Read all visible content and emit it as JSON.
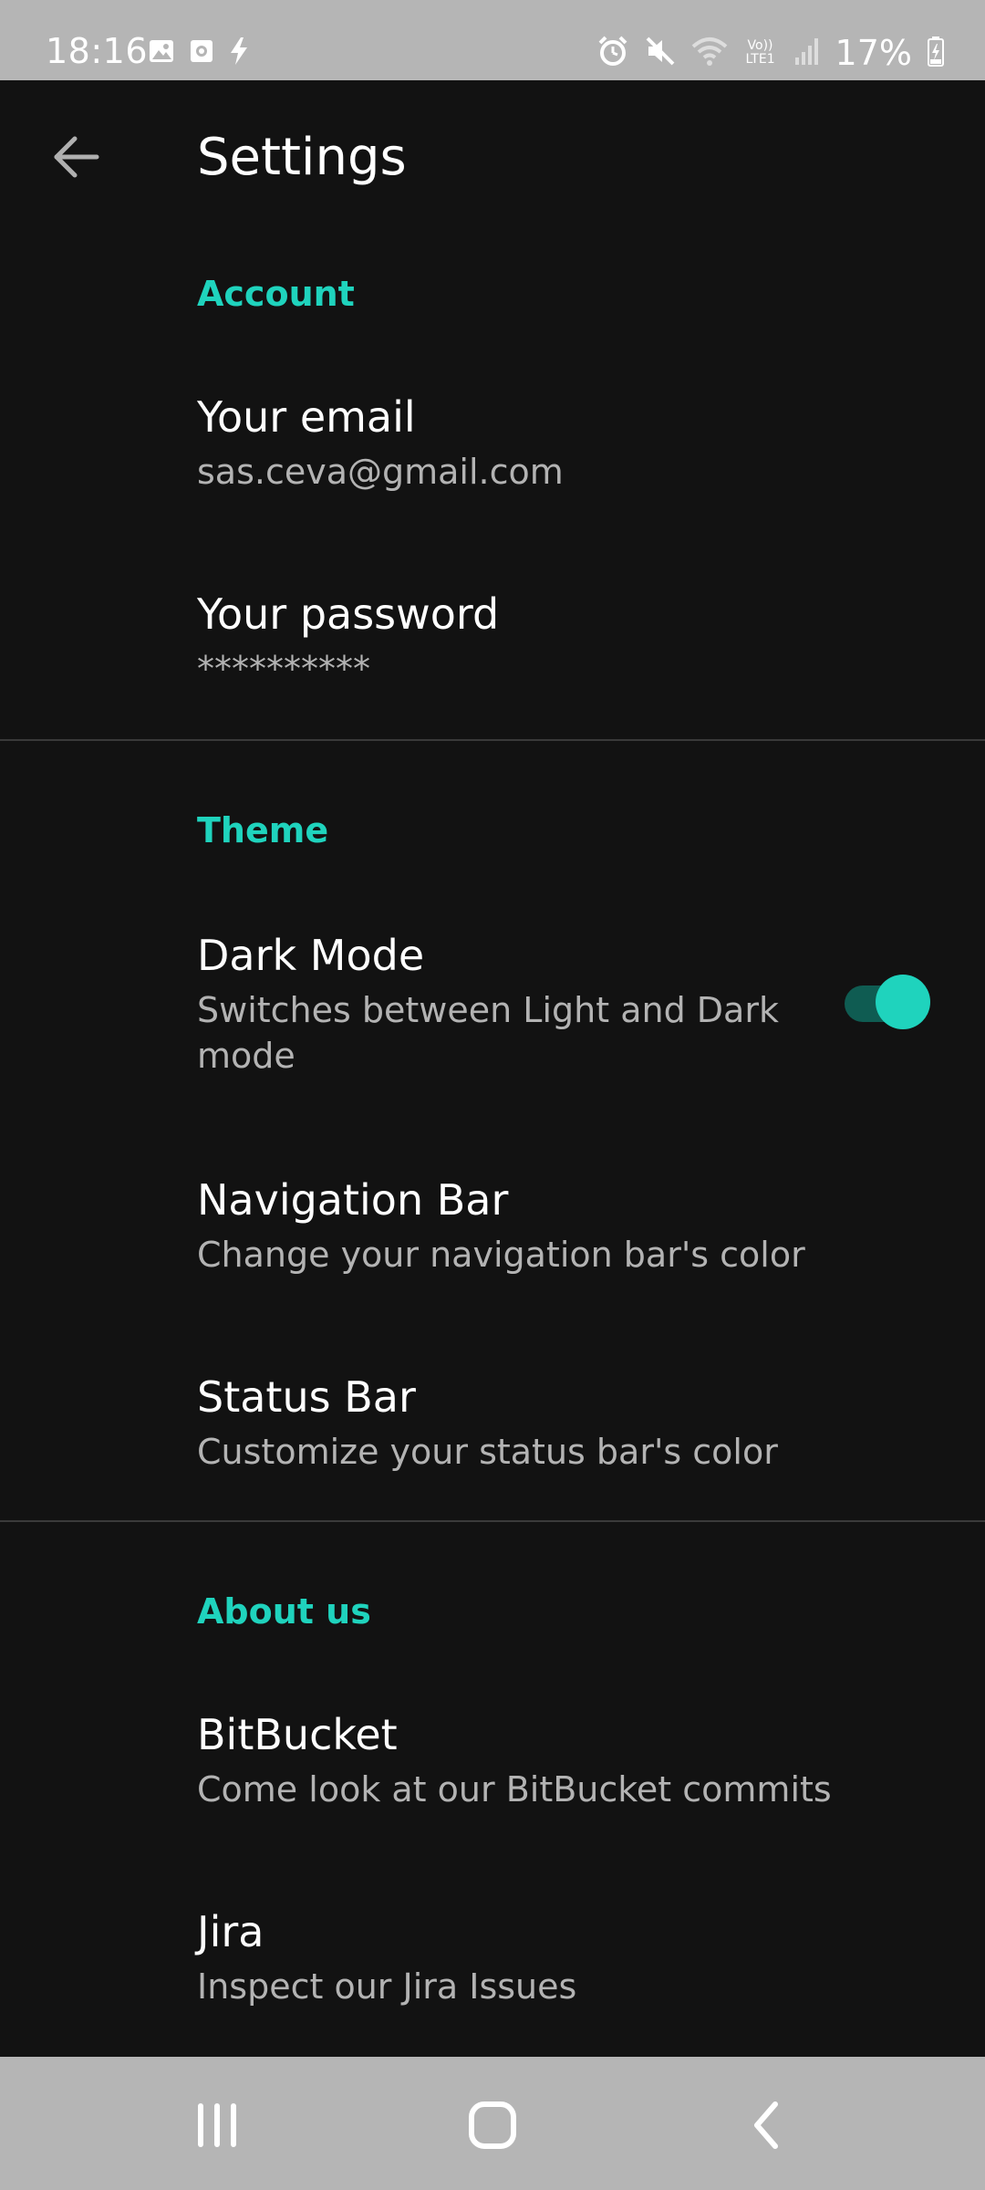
{
  "status_bar": {
    "time": "18:16",
    "battery": "17%",
    "left_icons": [
      "image-icon",
      "media-icon",
      "flash-icon"
    ],
    "right_icons": [
      "alarm-icon",
      "mute-icon",
      "wifi-icon",
      "volte-icon",
      "signal-icon",
      "battery-icon"
    ],
    "volte_label": "Vo)) LTE1"
  },
  "app_bar": {
    "title": "Settings",
    "back_icon": "arrow-back-icon"
  },
  "sections": {
    "account": {
      "header": "Account",
      "email_title": "Your email",
      "email_value": "sas.ceva@gmail.com",
      "password_title": "Your password",
      "password_value": "**********"
    },
    "theme": {
      "header": "Theme",
      "dark_mode_title": "Dark Mode",
      "dark_mode_summary": "Switches between Light and Dark mode",
      "dark_mode_enabled": true,
      "nav_bar_title": "Navigation Bar",
      "nav_bar_summary": "Change your navigation bar's color",
      "status_bar_title": "Status Bar",
      "status_bar_summary": "Customize your status bar's color"
    },
    "about": {
      "header": "About us",
      "bitbucket_title": "BitBucket",
      "bitbucket_summary": "Come look at our BitBucket commits",
      "jira_title": "Jira",
      "jira_summary": "Inspect our Jira Issues"
    }
  },
  "nav_bar": {
    "buttons": [
      "recents-icon",
      "home-icon",
      "back-icon"
    ]
  },
  "colors": {
    "background": "#121212",
    "accent": "#1fd3bd",
    "system_bars": "#b5b5b5",
    "primary_text": "#ffffff",
    "secondary_text": "#b3b3b3"
  }
}
